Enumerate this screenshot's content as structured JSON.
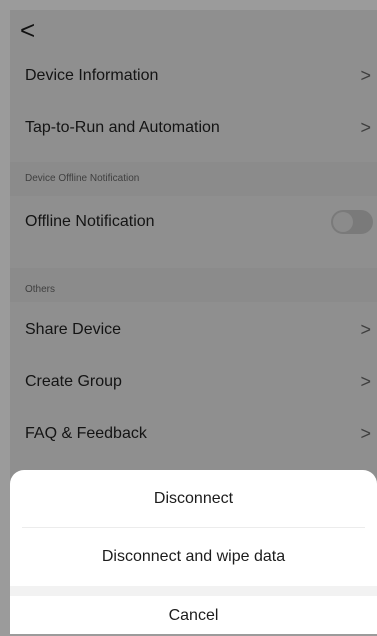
{
  "header": {
    "back_icon": "chevron-left-icon",
    "back_glyph": "<"
  },
  "settings": {
    "rows": [
      {
        "label": "Device Information",
        "chevron": ">"
      },
      {
        "label": "Tap-to-Run and Automation",
        "chevron": ">"
      }
    ],
    "offline_section_label": "Device Offline Notification",
    "offline_row": {
      "label": "Offline Notification",
      "toggle_on": false
    },
    "others_section_label": "Others",
    "others_rows": [
      {
        "label": "Share Device",
        "chevron": ">"
      },
      {
        "label": "Create Group",
        "chevron": ">"
      },
      {
        "label": "FAQ & Feedback",
        "chevron": ">"
      }
    ]
  },
  "sheet": {
    "disconnect": "Disconnect",
    "disconnect_wipe": "Disconnect and wipe data",
    "cancel": "Cancel"
  }
}
